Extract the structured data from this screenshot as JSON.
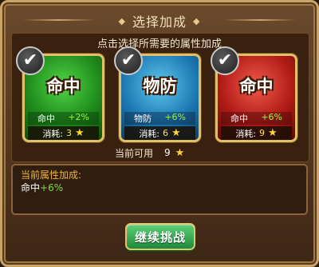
{
  "dialog": {
    "title": "选择加成",
    "instruction": "点击选择所需要的属性加成"
  },
  "cards": [
    {
      "name": "命中",
      "stat": "命中",
      "bonus": "+2%",
      "cost_label": "消耗:",
      "cost": "3",
      "color": "#1f8a1c",
      "checked": true
    },
    {
      "name": "物防",
      "stat": "物防",
      "bonus": "+6%",
      "cost_label": "消耗:",
      "cost": "6",
      "color": "#1d79b3",
      "checked": true
    },
    {
      "name": "命中",
      "stat": "命中",
      "bonus": "+6%",
      "cost_label": "消耗:",
      "cost": "9",
      "color": "#b01a16",
      "checked": true
    }
  ],
  "available": {
    "label": "当前可用",
    "value": "9"
  },
  "current_bonus": {
    "title": "当前属性加成:",
    "stat": "命中",
    "value": "+6%"
  },
  "continue_button": {
    "label": "继续挑战"
  },
  "icons": {
    "check": "check-icon",
    "star": "star-icon"
  }
}
